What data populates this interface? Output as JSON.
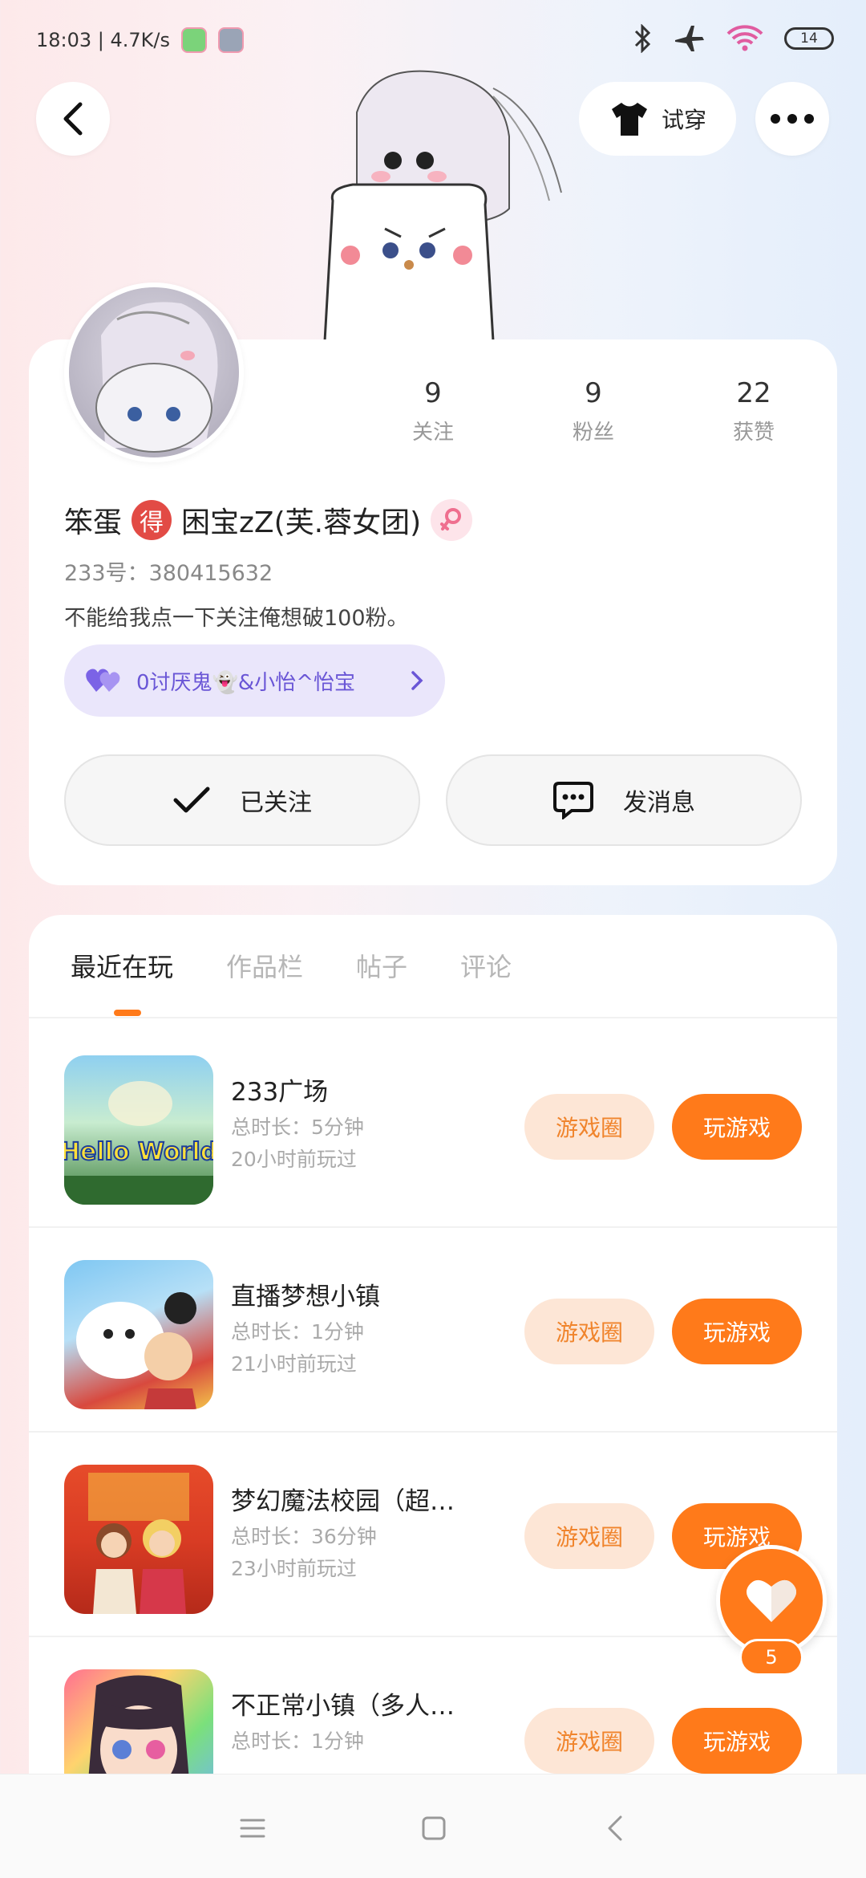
{
  "status_bar": {
    "time_speed": "18:03 | 4.7K/s",
    "battery": "14"
  },
  "header": {
    "try_outfit_label": "试穿"
  },
  "profile": {
    "stats": [
      {
        "value": "9",
        "label": "关注"
      },
      {
        "value": "9",
        "label": "粉丝"
      },
      {
        "value": "22",
        "label": "获赞"
      }
    ],
    "nickname_prefix": "笨蛋",
    "level_char": "得",
    "nickname_suffix": "困宝zZ(芙.蓉女团)",
    "user_id": "233号：380415632",
    "bio": "不能给我点一下关注俺想破100粉。",
    "cp_text": "0讨厌鬼👻&小怡^怡宝",
    "follow_label": "已关注",
    "message_label": "发消息"
  },
  "tabs": [
    "最近在玩",
    "作品栏",
    "帖子",
    "评论"
  ],
  "games": [
    {
      "title": "233广场",
      "duration": "总时长：5分钟",
      "played": "20小时前玩过",
      "circle_label": "游戏圈",
      "play_label": "玩游戏",
      "thumb_text": "Hello World"
    },
    {
      "title": "直播梦想小镇",
      "duration": "总时长：1分钟",
      "played": "21小时前玩过",
      "circle_label": "游戏圈",
      "play_label": "玩游戏",
      "thumb_text": ""
    },
    {
      "title": "梦幻魔法校园（超…",
      "duration": "总时长：36分钟",
      "played": "23小时前玩过",
      "circle_label": "游戏圈",
      "play_label": "玩游戏",
      "thumb_text": ""
    },
    {
      "title": "不正常小镇（多人…",
      "duration": "总时长：1分钟",
      "played": "",
      "circle_label": "游戏圈",
      "play_label": "玩游戏",
      "thumb_text": ""
    }
  ],
  "like_fab": {
    "count": "5"
  },
  "colors": {
    "accent": "#ff7a1a",
    "accent_light": "#fde6d6",
    "level_red": "#e24b45",
    "cp_purple": "#6a56d6"
  }
}
